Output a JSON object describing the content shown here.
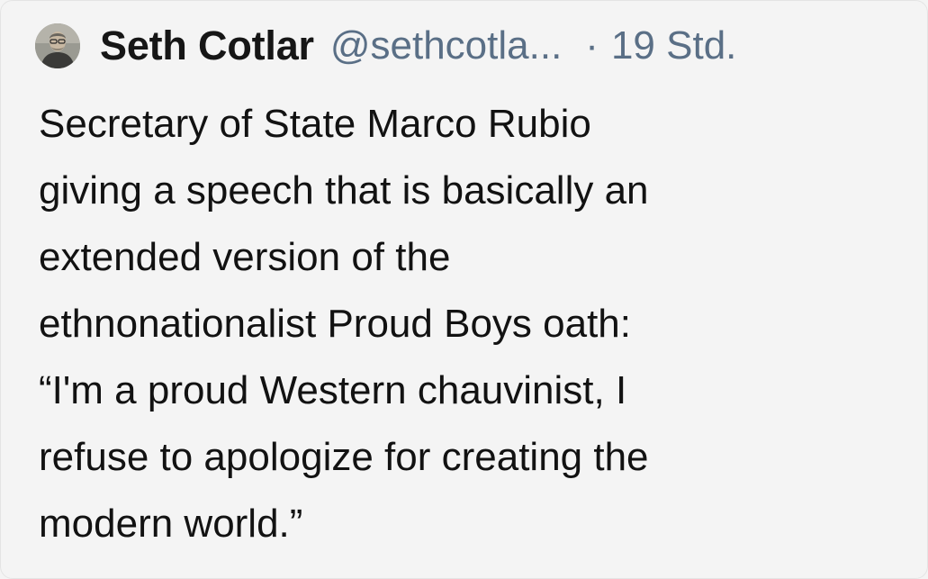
{
  "post": {
    "author": {
      "display_name": "Seth Cotlar",
      "handle": "@sethcotla...",
      "avatar_icon": "user-avatar-photo"
    },
    "separator": "·",
    "timestamp": "19 Std.",
    "text_lines": [
      "Secretary of State Marco Rubio",
      "giving a speech that is basically an",
      "extended version of the",
      "ethnonationalist Proud Boys oath:",
      "“I'm a proud Western chauvinist, I",
      "refuse to apologize for creating the",
      "modern world.”"
    ]
  },
  "colors": {
    "background": "#f4f4f4",
    "name": "#161616",
    "meta": "#5a6f86",
    "text": "#121212"
  }
}
